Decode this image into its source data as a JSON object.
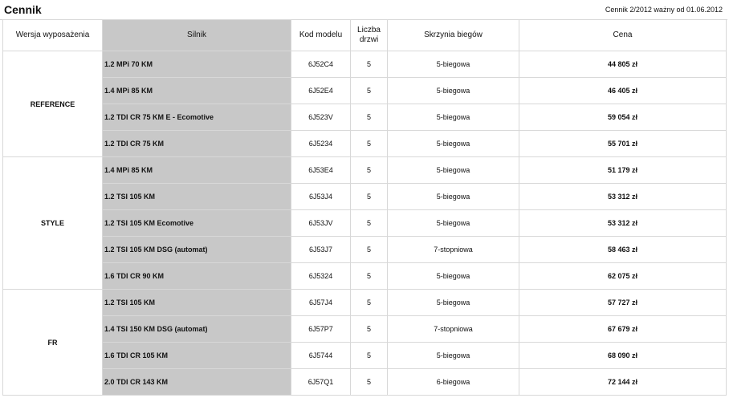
{
  "header": {
    "title": "Cennik",
    "validity": "Cennik 2/2012 ważny od 01.06.2012"
  },
  "table": {
    "columns": {
      "trim": "Wersja wyposażenia",
      "engine": "Silnik",
      "code": "Kod modelu",
      "doors_line1": "Liczba",
      "doors_line2": "drzwi",
      "gearbox": "Skrzynia biegów",
      "price": "Cena"
    },
    "groups": [
      {
        "trim": "REFERENCE",
        "rows": [
          {
            "engine": "1.2 MPi 70 KM",
            "code": "6J52C4",
            "doors": "5",
            "gearbox": "5-biegowa",
            "price": "44 805 zł"
          },
          {
            "engine": "1.4 MPi 85 KM",
            "code": "6J52E4",
            "doors": "5",
            "gearbox": "5-biegowa",
            "price": "46 405 zł"
          },
          {
            "engine": "1.2 TDI CR 75 KM E - Ecomotive",
            "code": "6J523V",
            "doors": "5",
            "gearbox": "5-biegowa",
            "price": "59 054 zł"
          },
          {
            "engine": "1.2 TDI CR 75 KM",
            "code": "6J5234",
            "doors": "5",
            "gearbox": "5-biegowa",
            "price": "55 701 zł"
          }
        ]
      },
      {
        "trim": "STYLE",
        "rows": [
          {
            "engine": "1.4 MPi 85 KM",
            "code": "6J53E4",
            "doors": "5",
            "gearbox": "5-biegowa",
            "price": "51 179 zł"
          },
          {
            "engine": "1.2 TSI 105 KM",
            "code": "6J53J4",
            "doors": "5",
            "gearbox": "5-biegowa",
            "price": "53 312 zł"
          },
          {
            "engine": "1.2 TSI 105 KM Ecomotive",
            "code": "6J53JV",
            "doors": "5",
            "gearbox": "5-biegowa",
            "price": "53 312 zł"
          },
          {
            "engine": "1.2 TSI 105 KM DSG (automat)",
            "code": "6J53J7",
            "doors": "5",
            "gearbox": "7-stopniowa",
            "price": "58 463 zł"
          },
          {
            "engine": "1.6 TDI CR 90 KM",
            "code": "6J5324",
            "doors": "5",
            "gearbox": "5-biegowa",
            "price": "62 075 zł"
          }
        ]
      },
      {
        "trim": "FR",
        "rows": [
          {
            "engine": "1.2 TSI 105 KM",
            "code": "6J57J4",
            "doors": "5",
            "gearbox": "5-biegowa",
            "price": "57 727 zł"
          },
          {
            "engine": "1.4 TSI 150 KM DSG (automat)",
            "code": "6J57P7",
            "doors": "5",
            "gearbox": "7-stopniowa",
            "price": "67 679 zł"
          },
          {
            "engine": "1.6 TDI CR 105 KM",
            "code": "6J5744",
            "doors": "5",
            "gearbox": "5-biegowa",
            "price": "68 090 zł"
          },
          {
            "engine": "2.0 TDI CR 143 KM",
            "code": "6J57Q1",
            "doors": "5",
            "gearbox": "6-biegowa",
            "price": "72 144 zł"
          }
        ]
      }
    ]
  }
}
